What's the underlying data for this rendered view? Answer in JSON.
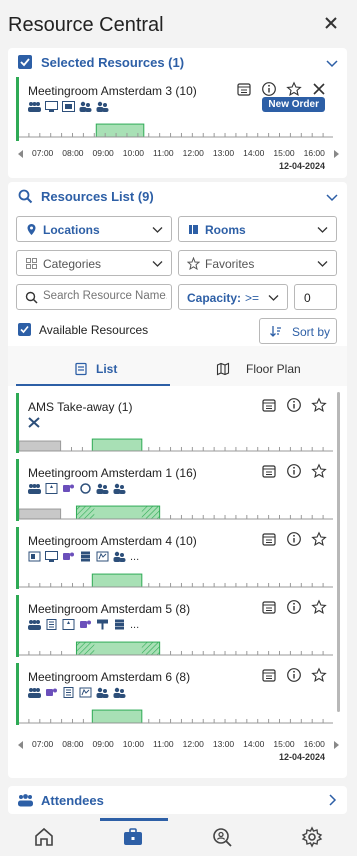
{
  "app": {
    "title": "Resource Central"
  },
  "selected": {
    "header": "Selected Resources (1)",
    "card": {
      "name": "Meetingroom Amsterdam 3 (10)",
      "new_order": "New Order"
    }
  },
  "timeline": {
    "hours": [
      "07:00",
      "08:00",
      "09:00",
      "10:00",
      "11:00",
      "12:00",
      "13:00",
      "14:00",
      "15:00",
      "16:00"
    ],
    "date": "12-04-2024"
  },
  "resources_list": {
    "header": "Resources List (9)",
    "filters": {
      "locations": "Locations",
      "rooms": "Rooms",
      "categories": "Categories",
      "favorites": "Favorites",
      "search_placeholder": "Search Resource Name...",
      "capacity_label": "Capacity:",
      "capacity_op": ">=",
      "capacity_value": "0",
      "available_label": "Available Resources",
      "sort_label": "Sort by"
    },
    "tabs": {
      "list": "List",
      "floor_plan": "Floor Plan"
    },
    "items": [
      {
        "name": "AMS Take-away (1)"
      },
      {
        "name": "Meetingroom Amsterdam 1 (16)",
        "more": "..."
      },
      {
        "name": "Meetingroom Amsterdam 4 (10)",
        "more": "..."
      },
      {
        "name": "Meetingroom Amsterdam 5 (8)",
        "more": "..."
      },
      {
        "name": "Meetingroom Amsterdam 6 (8)"
      }
    ]
  },
  "attendees": {
    "header": "Attendees"
  },
  "nav": {
    "items": [
      "home-icon",
      "briefcase-icon",
      "search-person-icon",
      "settings-icon"
    ]
  },
  "colors": {
    "accent": "#2d5fa6",
    "available": "#2eaa55",
    "booked_fill": "#a8e0b5",
    "busy": "#c8c8c8"
  }
}
